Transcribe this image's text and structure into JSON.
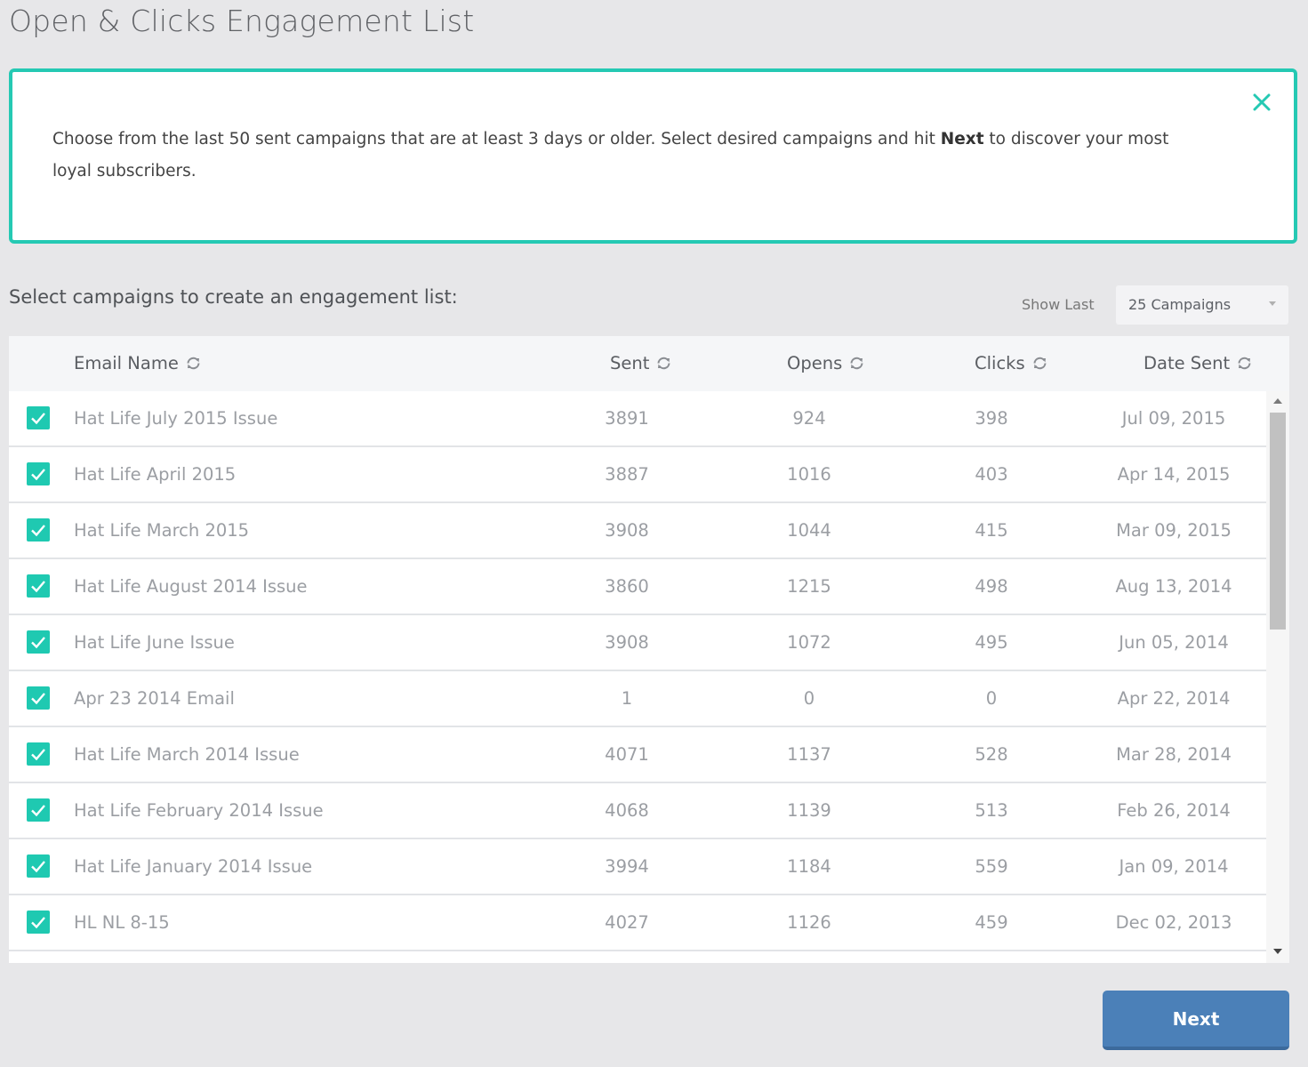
{
  "page": {
    "title": "Open & Clicks Engagement List"
  },
  "info": {
    "text_before": "Choose from the last 50 sent campaigns that are at least 3 days or older. Select desired campaigns and hit ",
    "text_bold": "Next",
    "text_after": " to discover your most loyal subscribers.",
    "close_icon": "close-icon",
    "accent_color": "#25c9b3"
  },
  "subhead": "Select campaigns to create an engagement list:",
  "show_last": {
    "label": "Show Last",
    "selected": "25 Campaigns"
  },
  "table": {
    "headers": [
      "Email Name",
      "Sent",
      "Opens",
      "Clicks",
      "Date Sent"
    ],
    "rows": [
      {
        "checked": true,
        "name": "Hat Life July 2015 Issue",
        "sent": "3891",
        "opens": "924",
        "clicks": "398",
        "date": "Jul 09, 2015"
      },
      {
        "checked": true,
        "name": "Hat Life April 2015",
        "sent": "3887",
        "opens": "1016",
        "clicks": "403",
        "date": "Apr 14, 2015"
      },
      {
        "checked": true,
        "name": "Hat Life March 2015",
        "sent": "3908",
        "opens": "1044",
        "clicks": "415",
        "date": "Mar 09, 2015"
      },
      {
        "checked": true,
        "name": "Hat Life August 2014 Issue",
        "sent": "3860",
        "opens": "1215",
        "clicks": "498",
        "date": "Aug 13, 2014"
      },
      {
        "checked": true,
        "name": "Hat Life June Issue",
        "sent": "3908",
        "opens": "1072",
        "clicks": "495",
        "date": "Jun 05, 2014"
      },
      {
        "checked": true,
        "name": "Apr 23 2014 Email",
        "sent": "1",
        "opens": "0",
        "clicks": "0",
        "date": "Apr 22, 2014"
      },
      {
        "checked": true,
        "name": "Hat Life March 2014 Issue",
        "sent": "4071",
        "opens": "1137",
        "clicks": "528",
        "date": "Mar 28, 2014"
      },
      {
        "checked": true,
        "name": "Hat Life February 2014 Issue",
        "sent": "4068",
        "opens": "1139",
        "clicks": "513",
        "date": "Feb 26, 2014"
      },
      {
        "checked": true,
        "name": "Hat Life January 2014 Issue",
        "sent": "3994",
        "opens": "1184",
        "clicks": "559",
        "date": "Jan 09, 2014"
      },
      {
        "checked": true,
        "name": "HL NL 8-15",
        "sent": "4027",
        "opens": "1126",
        "clicks": "459",
        "date": "Dec 02, 2013"
      }
    ]
  },
  "next_button": "Next",
  "colors": {
    "checkbox": "#1fc9b1",
    "primary_button": "#4b80b8"
  }
}
